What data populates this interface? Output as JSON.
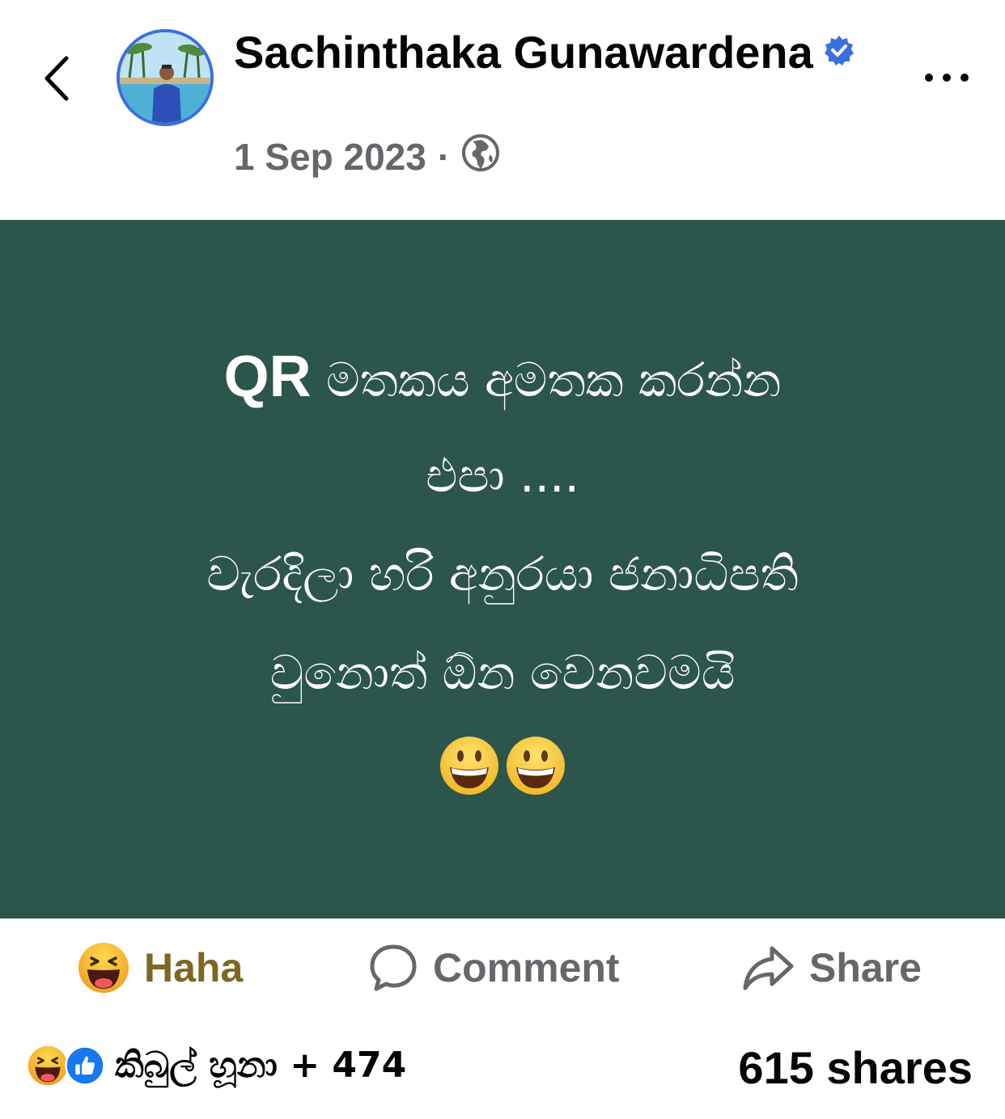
{
  "header": {
    "author_name": "Sachinthaka Gunawardena",
    "date": "1 Sep 2023",
    "separator": "·",
    "audience_icon": "globe-icon",
    "verified_icon": "verified-badge-icon",
    "back_icon": "chevron-left-icon",
    "more_icon": "more-dots-icon"
  },
  "post": {
    "background_color": "#2c554b",
    "text_color": "#ffffff",
    "lines": [
      {
        "prefix": "QR",
        "text": " මතකය අමතක කරන්න"
      },
      {
        "prefix": "",
        "text": "එපා ...."
      },
      {
        "prefix": "",
        "text": "වැරදිලා හරි අනුරයා ජනාධිපති"
      },
      {
        "prefix": "",
        "text": "වුනොත් ඕන වෙනවමයි"
      }
    ],
    "emojis": [
      "grinning-face-emoji",
      "grinning-face-emoji"
    ]
  },
  "actions": {
    "haha": {
      "label": "Haha",
      "icon": "haha-reaction-icon",
      "color": "#7c6820"
    },
    "comment": {
      "label": "Comment",
      "icon": "comment-bubble-icon"
    },
    "share": {
      "label": "Share",
      "icon": "share-arrow-icon"
    }
  },
  "footer": {
    "reaction_icons": [
      "haha-reaction-icon",
      "like-reaction-icon"
    ],
    "reactors_text": "කිබුල් හූනා + 474",
    "shares_text": "615 shares"
  },
  "colors": {
    "accent_blue": "#3a6fe0",
    "secondary_text": "#65676b"
  }
}
